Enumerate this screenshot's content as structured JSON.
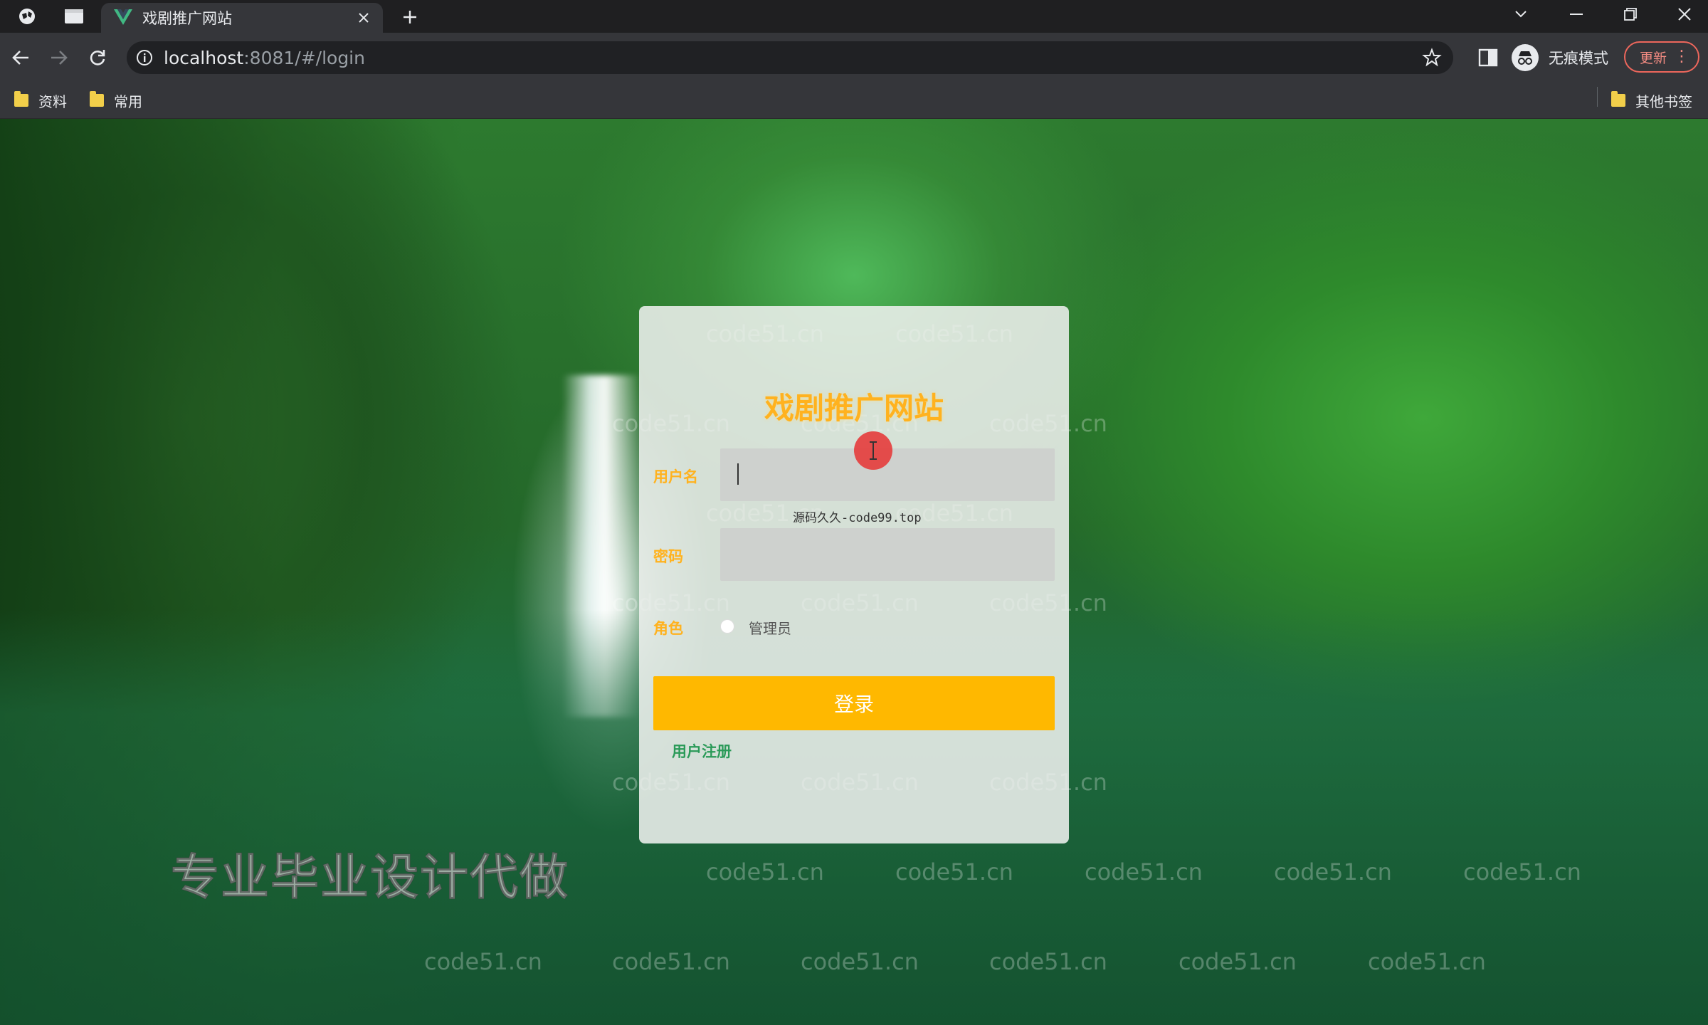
{
  "browser": {
    "tab_title": "戏剧推广网站",
    "url_host": "localhost",
    "url_rest": ":8081/#/login",
    "profile_label": "无痕模式",
    "update_label": "更新",
    "bookmarks": [
      "资料",
      "常用"
    ],
    "other_bookmarks": "其他书签"
  },
  "login": {
    "site_title": "戏剧推广网站",
    "username_label": "用户名",
    "password_label": "密码",
    "role_label": "角色",
    "role_option": "管理员",
    "login_button": "登录",
    "register_link": "用户注册",
    "overlay_tip": "源码久久-code99.top"
  },
  "overlay": {
    "watermark_text": "code51.cn",
    "promo_text": "专业毕业设计代做"
  },
  "colors": {
    "accent": "#ffb800",
    "title": "#ffb21f",
    "register": "#2a9a58"
  },
  "icons": [
    "globe-icon",
    "tab-list-icon",
    "vue-logo-icon",
    "close-icon",
    "plus-icon",
    "back-icon",
    "forward-icon",
    "reload-icon",
    "info-icon",
    "star-icon",
    "side-panel-icon",
    "incognito-icon",
    "folder-icon"
  ]
}
